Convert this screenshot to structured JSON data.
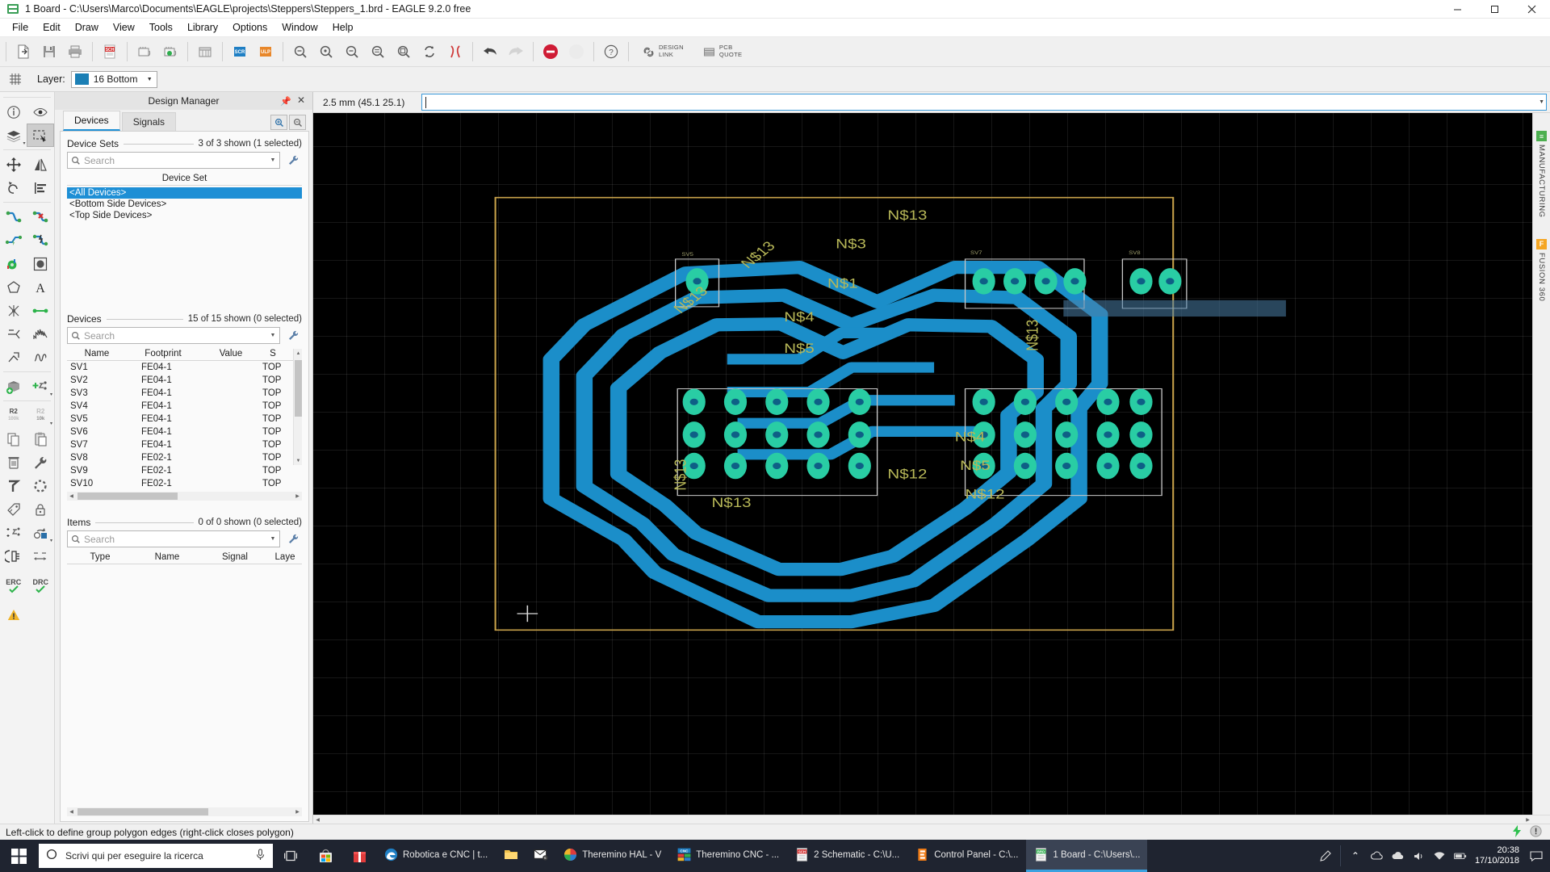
{
  "window": {
    "title": "1 Board - C:\\Users\\Marco\\Documents\\EAGLE\\projects\\Steppers\\Steppers_1.brd - EAGLE 9.2.0 free",
    "minimize": "─",
    "maximize": "❐",
    "close": "✕"
  },
  "menu": {
    "items": [
      "File",
      "Edit",
      "Draw",
      "View",
      "Tools",
      "Library",
      "Options",
      "Window",
      "Help"
    ]
  },
  "toolbar": {
    "buttons": [
      {
        "name": "new-icon",
        "label": "New"
      },
      {
        "name": "open-icon",
        "label": "Open"
      },
      {
        "name": "save-icon",
        "label": "Save"
      },
      {
        "name": "print-icon",
        "label": "Print"
      },
      {
        "name": "schematic-icon",
        "label": "SCH"
      },
      {
        "name": "board-from-schematic-icon",
        "label": "Board"
      },
      {
        "name": "generate-board-icon",
        "label": "Generate/Switch to Board"
      },
      {
        "name": "library-icon",
        "label": "Library"
      },
      {
        "name": "script-icon",
        "label": "SCR"
      },
      {
        "name": "ulp-icon",
        "label": "ULP"
      },
      {
        "name": "zoom-fit-icon",
        "label": "Zoom to fit"
      },
      {
        "name": "zoom-in-icon",
        "label": "Zoom in"
      },
      {
        "name": "zoom-out-icon",
        "label": "Zoom out"
      },
      {
        "name": "zoom-select-icon",
        "label": "Zoom select"
      },
      {
        "name": "zoom-redraw-icon",
        "label": "Redraw"
      },
      {
        "name": "refresh-icon",
        "label": "Refresh"
      },
      {
        "name": "ratsnest-icon",
        "label": "Ratsnest"
      },
      {
        "name": "undo-icon",
        "label": "Undo"
      },
      {
        "name": "redo-icon",
        "label": "Redo"
      },
      {
        "name": "stop-icon",
        "label": "Stop"
      },
      {
        "name": "autorouter-icon",
        "label": "Autorouter"
      },
      {
        "name": "help-icon",
        "label": "Help"
      }
    ],
    "design_link": "DESIGN\nLINK",
    "design_link_l1": "DESIGN",
    "design_link_l2": "LINK",
    "pcb_quote_l1": "PCB",
    "pcb_quote_l2": "QUOTE"
  },
  "layerbar": {
    "grid_icon": "grid-icon",
    "label": "Layer:",
    "selected_layer": "16 Bottom",
    "swatch_color": "#1b7fb5",
    "arrow": "▼"
  },
  "palette": {
    "rows": [
      [
        {
          "name": "info-icon",
          "sel": false
        },
        {
          "name": "show-icon",
          "sel": false
        }
      ],
      [
        {
          "name": "display-layers-icon",
          "sel": false,
          "drop": true
        },
        {
          "name": "group-select-icon",
          "sel": true
        }
      ],
      [
        {
          "name": "move-icon",
          "sel": false
        },
        {
          "name": "mirror-icon",
          "sel": false
        }
      ],
      [
        {
          "name": "rotate-icon",
          "sel": false
        },
        {
          "name": "align-icon",
          "sel": false
        }
      ],
      [
        {
          "name": "route-icon",
          "sel": false
        },
        {
          "name": "ripup-icon",
          "sel": false
        }
      ],
      [
        {
          "name": "via-route-icon",
          "sel": false
        },
        {
          "name": "autoroute-icon",
          "sel": false
        }
      ],
      [
        {
          "name": "polygon-fill-icon",
          "sel": false
        },
        {
          "name": "via-icon",
          "sel": false
        }
      ],
      [
        {
          "name": "polygon-icon",
          "sel": false
        },
        {
          "name": "text-icon",
          "sel": false
        }
      ],
      [
        {
          "name": "split-icon",
          "sel": false
        },
        {
          "name": "wire-icon",
          "sel": false
        }
      ],
      [
        {
          "name": "meander-icon",
          "sel": false
        },
        {
          "name": "miter-icon",
          "sel": false
        }
      ],
      [
        {
          "name": "slice-icon",
          "sel": false
        },
        {
          "name": "signal-icon",
          "sel": false
        }
      ],
      [
        {
          "name": "add-package-icon",
          "sel": false
        },
        {
          "name": "add-part-icon",
          "sel": false,
          "drop": true
        }
      ],
      [
        {
          "name": "value-r2-icon",
          "sel": false
        },
        {
          "name": "smash-icon",
          "sel": false,
          "drop": true
        }
      ],
      [
        {
          "name": "copy-icon",
          "sel": false
        },
        {
          "name": "paste-icon",
          "sel": false
        }
      ],
      [
        {
          "name": "delete-icon",
          "sel": false
        },
        {
          "name": "change-icon",
          "sel": false
        }
      ],
      [
        {
          "name": "paint-icon",
          "sel": false
        },
        {
          "name": "dashed-circle-icon",
          "sel": false
        }
      ],
      [
        {
          "name": "attribute-icon",
          "sel": false
        },
        {
          "name": "lock-icon",
          "sel": false
        }
      ],
      [
        {
          "name": "add-attribute-icon",
          "sel": false
        },
        {
          "name": "drc-run-icon",
          "sel": false,
          "drop": true
        }
      ],
      [
        {
          "name": "connector-icon",
          "sel": false
        },
        {
          "name": "dimension-icon",
          "sel": false
        }
      ],
      [
        {
          "name": "erc-icon",
          "sel": false,
          "label": "ERC"
        },
        {
          "name": "drc-icon",
          "sel": false,
          "label": "DRC"
        }
      ],
      [
        {
          "name": "warning-icon",
          "sel": false
        }
      ]
    ],
    "erc_label": "ERC",
    "drc_label": "DRC"
  },
  "design_manager": {
    "title": "Design Manager",
    "pin_icon": "pin-icon",
    "close_icon": "close-icon",
    "tabs": [
      {
        "label": "Devices",
        "active": true
      },
      {
        "label": "Signals",
        "active": false
      }
    ],
    "tab_buttons": [
      {
        "name": "zoom-to-selection-icon"
      },
      {
        "name": "zoom-out-selection-icon"
      }
    ],
    "device_sets": {
      "heading": "Device Sets",
      "count": "3 of 3 shown (1 selected)",
      "search_placeholder": "Search",
      "column": "Device Set",
      "rows": [
        {
          "label": "<All Devices>",
          "selected": true
        },
        {
          "label": "<Bottom Side Devices>",
          "selected": false
        },
        {
          "label": "<Top Side Devices>",
          "selected": false
        }
      ]
    },
    "devices": {
      "heading": "Devices",
      "count": "15 of 15 shown (0 selected)",
      "search_placeholder": "Search",
      "columns": [
        "Name",
        "Footprint",
        "Value",
        "S"
      ],
      "rows": [
        [
          "SV1",
          "FE04-1",
          "",
          "TOP"
        ],
        [
          "SV2",
          "FE04-1",
          "",
          "TOP"
        ],
        [
          "SV3",
          "FE04-1",
          "",
          "TOP"
        ],
        [
          "SV4",
          "FE04-1",
          "",
          "TOP"
        ],
        [
          "SV5",
          "FE04-1",
          "",
          "TOP"
        ],
        [
          "SV6",
          "FE04-1",
          "",
          "TOP"
        ],
        [
          "SV7",
          "FE04-1",
          "",
          "TOP"
        ],
        [
          "SV8",
          "FE02-1",
          "",
          "TOP"
        ],
        [
          "SV9",
          "FE02-1",
          "",
          "TOP"
        ],
        [
          "SV10",
          "FE02-1",
          "",
          "TOP"
        ]
      ]
    },
    "items": {
      "heading": "Items",
      "count": "0 of 0 shown (0 selected)",
      "search_placeholder": "Search",
      "columns": [
        "Type",
        "Name",
        "Signal",
        "Laye"
      ],
      "rows": []
    }
  },
  "command_bar": {
    "coordinates": "2.5 mm (45.1 25.1)",
    "input_value": "",
    "dropdown_arrow": "▼"
  },
  "canvas": {
    "background": "#000000",
    "board_outline_color": "#c8a24a",
    "trace_color": "#1b8ec9",
    "pad_color": "#26c9a0",
    "net_label_color": "#b8b858",
    "net_labels": [
      "N$13",
      "N$13",
      "N$3",
      "N$1",
      "N$4",
      "N$5",
      "N$13",
      "N$13",
      "N$13",
      "N$12",
      "N$13",
      "N$4",
      "N$5",
      "N$12",
      "N$13"
    ],
    "crosshair": "crosshair-cursor"
  },
  "right_rail": {
    "items": [
      {
        "label": "MANUFACTURING",
        "badge": "≡",
        "color": "#4caf50"
      },
      {
        "label": "FUSION 360",
        "badge": "F",
        "color": "#f5a623"
      }
    ]
  },
  "status_bar": {
    "message": "Left-click to define group polygon edges (right-click closes polygon)",
    "icons": [
      "lightning-icon",
      "exclamation-icon"
    ]
  },
  "taskbar": {
    "start_icon": "windows-start-icon",
    "search_placeholder": "Scrivi qui per eseguire la ricerca",
    "search_icon": "search-circle-icon",
    "mic_icon": "microphone-icon",
    "taskview_icon": "task-view-icon",
    "pinned": [
      {
        "name": "microsoft-store-icon"
      },
      {
        "name": "gift-app-icon"
      }
    ],
    "tasks": [
      {
        "label": "Robotica e CNC | t...",
        "icon": "edge-icon",
        "active": false
      },
      {
        "label": "",
        "icon": "file-explorer-icon",
        "active": false
      },
      {
        "label": "",
        "icon": "mail-icon",
        "badge": "6",
        "active": false
      },
      {
        "label": "Theremino HAL - V",
        "icon": "theremino-hal-icon",
        "active": false
      },
      {
        "label": "Theremino CNC - ...",
        "icon": "theremino-cnc-icon",
        "active": false
      },
      {
        "label": "2 Schematic - C:\\U...",
        "icon": "eagle-sch-icon",
        "active": false
      },
      {
        "label": "Control Panel - C:\\...",
        "icon": "eagle-control-panel-icon",
        "active": false
      },
      {
        "label": "1 Board - C:\\Users\\...",
        "icon": "eagle-brd-icon",
        "active": true
      }
    ],
    "tray": {
      "pen_icon": "pen-tray-icon",
      "chevron": "⌃",
      "icons": [
        "onedrive-icon",
        "cloud-icon",
        "speaker-icon",
        "network-icon",
        "battery-icon"
      ],
      "time": "20:38",
      "date": "17/10/2018",
      "action_center": "notification-icon"
    }
  }
}
